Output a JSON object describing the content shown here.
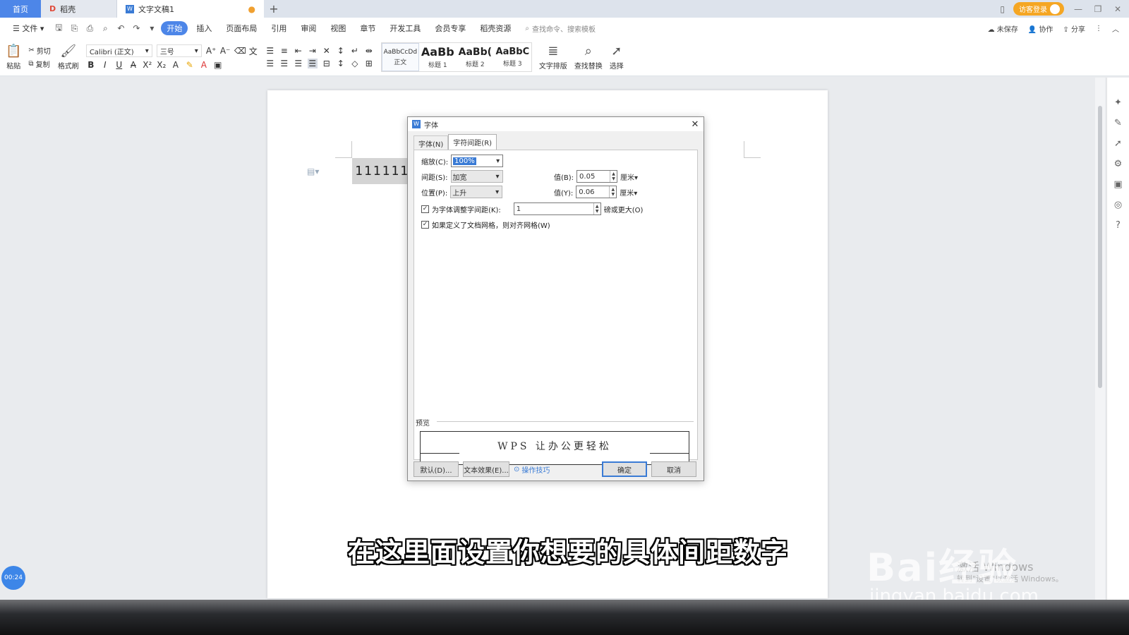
{
  "titlebar": {
    "tabs": [
      {
        "label": "首页"
      },
      {
        "label": "稻壳"
      },
      {
        "label": "文字文稿1"
      }
    ],
    "login_label": "访客登录"
  },
  "menubar": {
    "file_label": "文件",
    "items": [
      "开始",
      "插入",
      "页面布局",
      "引用",
      "审阅",
      "视图",
      "章节",
      "开发工具",
      "会员专享",
      "稻壳资源"
    ],
    "search_placeholder": "查找命令、搜索模板",
    "unsaved": "未保存",
    "collab": "协作",
    "share": "分享"
  },
  "ribbon": {
    "paste": "粘贴",
    "cut": "剪切",
    "copy": "复制",
    "format_painter": "格式刷",
    "font_name": "Calibri (正文)",
    "font_size": "三号",
    "styles": [
      {
        "sample": "AaBbCcDd",
        "caption": "正文"
      },
      {
        "sample": "AaBb",
        "caption": "标题 1"
      },
      {
        "sample": "AaBb(",
        "caption": "标题 2"
      },
      {
        "sample": "AaBbC",
        "caption": "标题 3"
      }
    ],
    "text_layout": "文字排版",
    "find_replace": "查找替换",
    "select": "选择"
  },
  "document": {
    "text": "1111111"
  },
  "dialog": {
    "title": "字体",
    "tabs": [
      "字体(N)",
      "字符间距(R)"
    ],
    "scale_label": "缩放(C):",
    "scale_value": "100%",
    "spacing_label": "间距(S):",
    "spacing_value": "加宽",
    "spacing_by_label": "值(B):",
    "spacing_by_value": "0.05",
    "position_label": "位置(P):",
    "position_value": "上升",
    "position_by_label": "值(Y):",
    "position_by_value": "0.06",
    "unit": "厘米",
    "kerning_label": "为字体调整字间距(K):",
    "kerning_value": "1",
    "kerning_suffix": "磅或更大(O)",
    "kerning_checked": true,
    "snap_grid_label": "如果定义了文档网格，则对齐网格(W)",
    "snap_grid_checked": true,
    "preview_label": "预览",
    "preview_text": "WPS 让办公更轻松",
    "default_button": "默认(D)...",
    "text_effects_button": "文本效果(E)...",
    "tips_link": "操作技巧",
    "ok_button": "确定",
    "cancel_button": "取消"
  },
  "overlay": {
    "caption": "在这里面设置你想要的具体间距数字",
    "watermark_brand": "Bai经验",
    "watermark_url": "jingyan.baidu.com",
    "activate_title": "激活 Windows",
    "activate_sub": "转到\"设置\"以激活 Windows。",
    "timer": "00:24"
  }
}
